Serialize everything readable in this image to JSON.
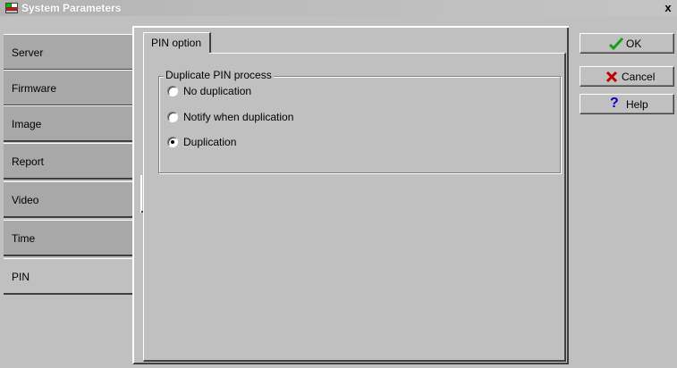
{
  "window": {
    "title": "System Parameters",
    "close_glyph": "x"
  },
  "sidebar": {
    "tabs": [
      {
        "label": "Server",
        "active": false
      },
      {
        "label": "Firmware",
        "active": false
      },
      {
        "label": "Image",
        "active": false
      },
      {
        "label": "Report",
        "active": false
      },
      {
        "label": "Video",
        "active": false
      },
      {
        "label": "Time",
        "active": false
      },
      {
        "label": "PIN",
        "active": true
      }
    ]
  },
  "page": {
    "tab_label": "PIN option",
    "group": {
      "legend": "Duplicate PIN process",
      "options": [
        {
          "label": "No duplication",
          "checked": false
        },
        {
          "label": "Notify when duplication",
          "checked": false
        },
        {
          "label": "Duplication",
          "checked": true
        }
      ]
    }
  },
  "buttons": {
    "ok": {
      "label": "OK",
      "icon": "check-icon"
    },
    "cancel": {
      "label": "Cancel",
      "icon": "x-icon"
    },
    "help": {
      "label": "Help",
      "icon": "question-icon"
    }
  },
  "colors": {
    "ok_icon": "#1a9e1a",
    "cancel_icon": "#c00000",
    "help_icon": "#0000c8"
  }
}
